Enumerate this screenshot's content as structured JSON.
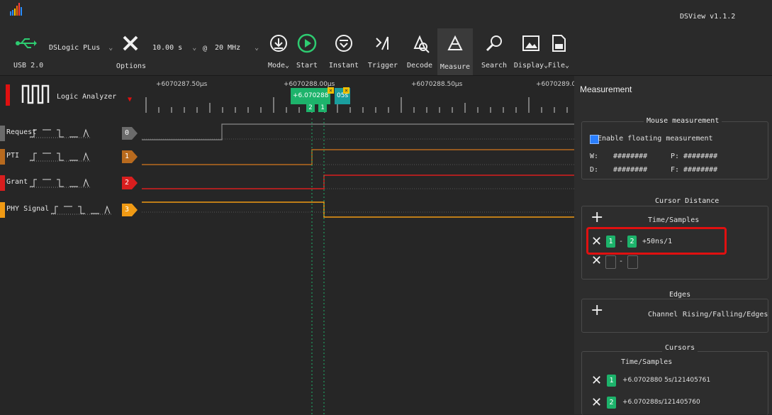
{
  "app": {
    "title": "DSView v1.1.2"
  },
  "toolbar": {
    "device_name": "DSLogic PLus",
    "usb_label": "USB 2.0",
    "options_label": "Options",
    "sample_time": "10.00 s",
    "at_symbol": "@",
    "sample_rate": "20 MHz",
    "mode_label": "Mode",
    "start_label": "Start",
    "instant_label": "Instant",
    "trigger_label": "Trigger",
    "decode_label": "Decode",
    "measure_label": "Measure",
    "search_label": "Search",
    "display_label": "Display",
    "file_label": "File"
  },
  "logic": {
    "title": "Logic Analyzer",
    "ruler_labels": [
      "+6070287.50μs",
      "+6070288.00μs",
      "+6070288.50μs",
      "+6070289.0"
    ],
    "cursor_flag_time": "+6.070288",
    "cursor_flag_suffix": "05s",
    "cursor_markers": [
      "2",
      "1"
    ],
    "channels": [
      {
        "name": "Request",
        "num": "0",
        "color": "#6b6b6b"
      },
      {
        "name": "PTI",
        "num": "1",
        "color": "#b86a1e"
      },
      {
        "name": "Grant",
        "num": "2",
        "color": "#d81e1e"
      },
      {
        "name": "PHY Signal",
        "num": "3",
        "color": "#f09a14"
      }
    ],
    "trigger_glyphs": "_‾‾┐_└‾→"
  },
  "panel": {
    "title": "Measurement",
    "mouse": {
      "title": "Mouse measurement",
      "enable_label": "Enable floating measurement",
      "w_label": "W:",
      "w_value": "########",
      "p_label": "P:",
      "p_value": "########",
      "d_label": "D:",
      "d_value": "########",
      "f_label": "F:",
      "f_value": "########"
    },
    "cursor_distance": {
      "title": "Cursor Distance",
      "col_header": "Time/Samples",
      "row1_a": "1",
      "row1_sep": "-",
      "row1_b": "2",
      "row1_value": "+50ns/1",
      "row2_sep": "-"
    },
    "edges": {
      "title": "Edges",
      "col_channel": "Channel",
      "col_edges": "Rising/Falling/Edges"
    },
    "cursors": {
      "title": "Cursors",
      "col_header": "Time/Samples",
      "items": [
        {
          "num": "1",
          "value": "+6.0702880 5s/121405761"
        },
        {
          "num": "2",
          "value": "+6.070288s/121405760"
        }
      ]
    }
  },
  "colors": {
    "cursor_green": "#1db36b",
    "highlight_red": "#e01010",
    "request": "#6b6b6b",
    "pti": "#b86a1e",
    "grant": "#d81e1e",
    "phy": "#f09a14"
  }
}
